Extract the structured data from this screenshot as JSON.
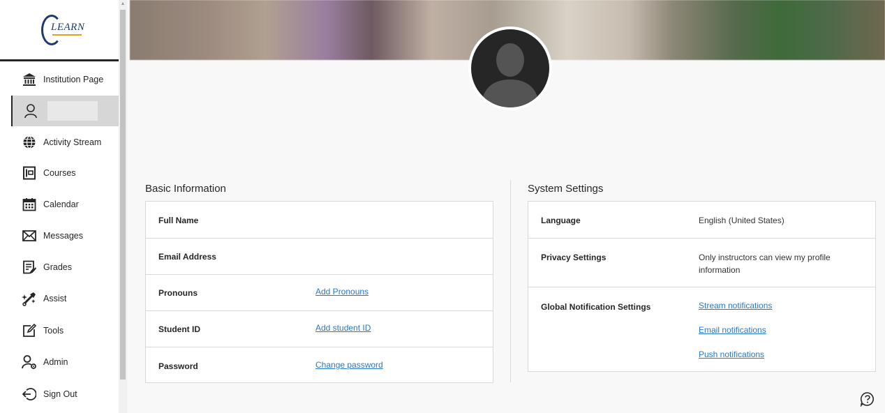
{
  "logo": {
    "text": "LEARN"
  },
  "sidebar": {
    "items": [
      {
        "label": "Institution Page",
        "icon": "institution-icon"
      },
      {
        "label": "",
        "icon": "user-icon"
      },
      {
        "label": "Activity Stream",
        "icon": "globe-icon"
      },
      {
        "label": "Courses",
        "icon": "courses-icon"
      },
      {
        "label": "Calendar",
        "icon": "calendar-icon"
      },
      {
        "label": "Messages",
        "icon": "envelope-icon"
      },
      {
        "label": "Grades",
        "icon": "grades-icon"
      },
      {
        "label": "Assist",
        "icon": "assist-icon"
      },
      {
        "label": "Tools",
        "icon": "tools-icon"
      },
      {
        "label": "Admin",
        "icon": "admin-icon"
      },
      {
        "label": "Sign Out",
        "icon": "sign-out-icon"
      }
    ]
  },
  "basic_info": {
    "title": "Basic Information",
    "rows": [
      {
        "label": "Full Name",
        "value": ""
      },
      {
        "label": "Email Address",
        "value": ""
      },
      {
        "label": "Pronouns",
        "link": "Add Pronouns"
      },
      {
        "label": "Student ID",
        "link": "Add student ID"
      },
      {
        "label": "Password",
        "link": "Change password"
      }
    ]
  },
  "system_settings": {
    "title": "System Settings",
    "language": {
      "label": "Language",
      "value": "English (United States)"
    },
    "privacy": {
      "label": "Privacy Settings",
      "value": "Only instructors can view my profile information"
    },
    "notifications": {
      "label": "Global Notification Settings",
      "links": [
        "Stream notifications",
        "Email notifications",
        "Push notifications"
      ]
    }
  },
  "colors": {
    "link": "#2a78c5",
    "text": "#262626",
    "active_nav": "#d6d6d6"
  }
}
